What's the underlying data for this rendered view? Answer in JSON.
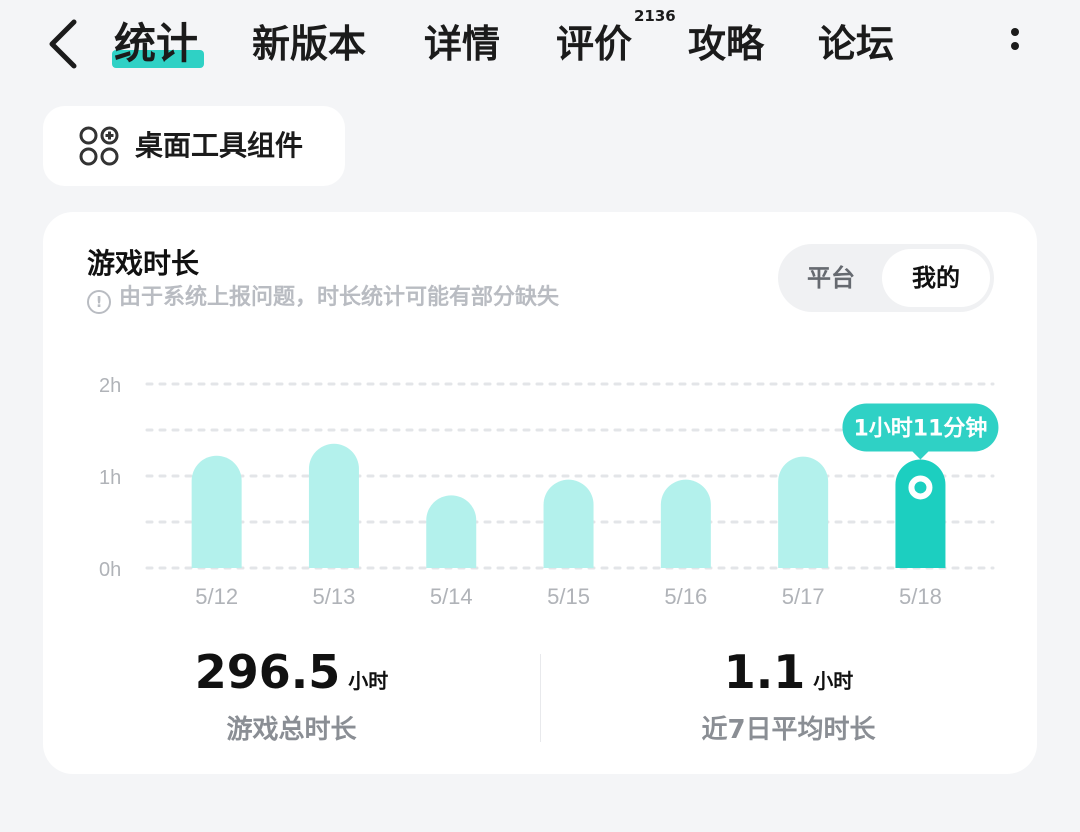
{
  "nav": {
    "tabs": [
      {
        "label": "统计",
        "active": true
      },
      {
        "label": "新版本"
      },
      {
        "label": "详情"
      },
      {
        "label": "评价",
        "badge": "2136"
      },
      {
        "label": "攻略"
      },
      {
        "label": "论坛"
      }
    ]
  },
  "widget_button": {
    "label": "桌面工具组件",
    "icon": "widget-grid-plus-icon"
  },
  "card": {
    "title": "游戏时长",
    "note": "由于系统上报问题，时长统计可能有部分缺失",
    "note_icon": "info-icon",
    "toggle": {
      "options": [
        "平台",
        "我的"
      ],
      "selected": "我的"
    },
    "stats": [
      {
        "value": "296.5",
        "unit": "小时",
        "label": "游戏总时长"
      },
      {
        "value": "1.1",
        "unit": "小时",
        "label": "近7日平均时长"
      }
    ]
  },
  "chart_data": {
    "type": "bar",
    "categories": [
      "5/12",
      "5/13",
      "5/14",
      "5/15",
      "5/16",
      "5/17",
      "5/18"
    ],
    "values": [
      1.22,
      1.35,
      0.79,
      0.96,
      0.96,
      1.21,
      1.18
    ],
    "unit": "h",
    "yticks": [
      {
        "value": 0,
        "label": "0h"
      },
      {
        "value": 1,
        "label": "1h"
      },
      {
        "value": 2,
        "label": "2h"
      }
    ],
    "ylim": [
      0,
      2
    ],
    "highlight_index": 6,
    "highlight_label": "1小时11分钟",
    "colors": {
      "bar": "#b3f1ec",
      "highlight": "#1ccfc0",
      "tooltip": "#2fd1c5",
      "grid": "#e3e5e8",
      "tick": "#b0b3b8"
    }
  }
}
